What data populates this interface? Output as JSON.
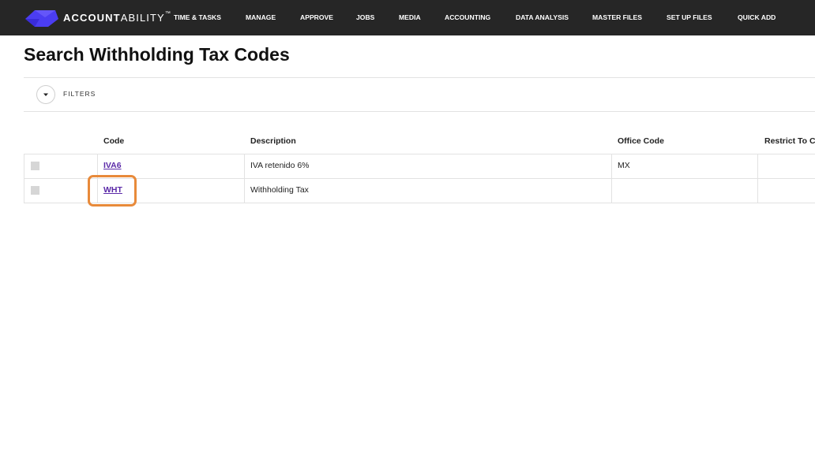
{
  "brand": {
    "name_bold": "ACCOUNT",
    "name_light": "ABILITY",
    "trademark": "™",
    "logo_color": "#4b3df2"
  },
  "nav": {
    "items": [
      "TIME & TASKS",
      "MANAGE",
      "APPROVE",
      "JOBS",
      "MEDIA",
      "ACCOUNTING",
      "DATA ANALYSIS",
      "MASTER FILES",
      "SET UP FILES",
      "QUICK ADD"
    ]
  },
  "page": {
    "title": "Search Withholding Tax Codes"
  },
  "filters": {
    "label": "FILTERS",
    "toggle_icon": "caret-down-icon"
  },
  "table": {
    "columns": [
      "Code",
      "Description",
      "Office Code",
      "Restrict To C"
    ],
    "rows": [
      {
        "code": "IVA6",
        "description": "IVA retenido 6%",
        "office_code": "MX",
        "restrict_to": ""
      },
      {
        "code": "WHT",
        "description": "Withholding Tax",
        "office_code": "",
        "restrict_to": ""
      }
    ]
  },
  "colors": {
    "nav_bg": "#262626",
    "link": "#5b2aa8",
    "highlight": "#e88a3a"
  }
}
